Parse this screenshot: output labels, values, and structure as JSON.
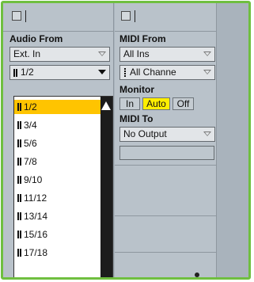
{
  "audio_strip": {
    "audio_from_label": "Audio From",
    "input_type": "Ext. In",
    "input_channel": "1/2"
  },
  "midi_strip": {
    "midi_from_label": "MIDI From",
    "midi_from_value": "All Ins",
    "channel_value": "All Channe",
    "monitor_label": "Monitor",
    "monitor_in": "In",
    "monitor_auto": "Auto",
    "monitor_off": "Off",
    "monitor_active": "Auto",
    "midi_to_label": "MIDI To",
    "midi_to_value": "No Output"
  },
  "dropdown": {
    "items": [
      "1/2",
      "3/4",
      "5/6",
      "7/8",
      "9/10",
      "11/12",
      "13/14",
      "15/16",
      "17/18"
    ],
    "selected": "1/2"
  },
  "colors": {
    "frame_border": "#6fbf3f",
    "selected_item": "#ffc400",
    "auto_active": "#ffee00"
  }
}
